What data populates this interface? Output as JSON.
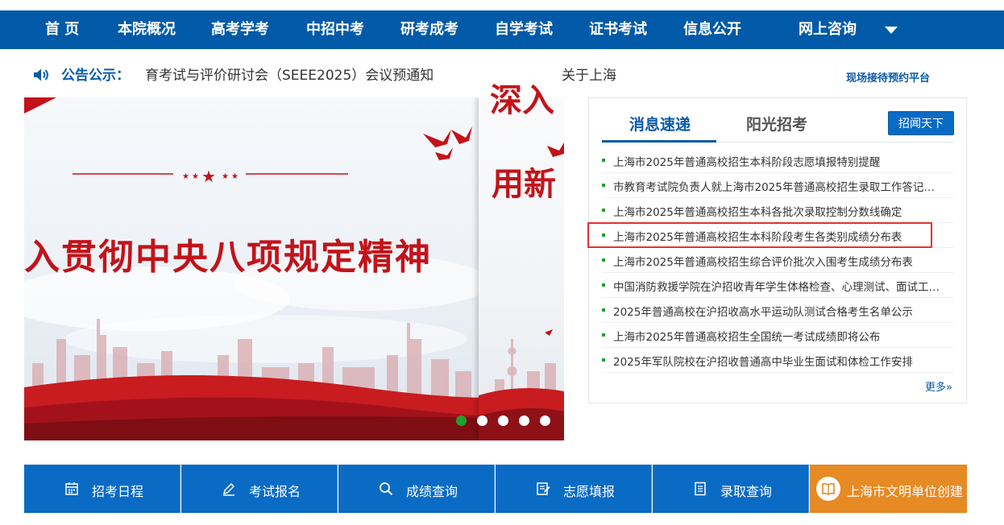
{
  "nav": {
    "items": [
      "首 页",
      "本院概况",
      "高考学考",
      "中招中考",
      "研考成考",
      "自学考试",
      "证书考试",
      "信息公开",
      "网上咨询"
    ]
  },
  "notice": {
    "label": "公告公示：",
    "marquee": [
      "育考试与评价研讨会（SEEE2025）会议预通知",
      "关于上海"
    ],
    "reservation": "现场接待预约平台"
  },
  "banner": {
    "slogan_main": "入贯彻中央八项规定精神",
    "slogan_right_top": "深入",
    "slogan_right_bottom": "用新",
    "slides_count": 5,
    "active_slide": 0
  },
  "news": {
    "tabs": [
      "消息速递",
      "阳光招考"
    ],
    "active_tab": 0,
    "button": "招闻天下",
    "items": [
      "上海市2025年普通高校招生本科阶段志愿填报特别提醒",
      "市教育考试院负责人就上海市2025年普通高校招生录取工作答记者问",
      "上海市2025年普通高校招生本科各批次录取控制分数线确定",
      "上海市2025年普通高校招生本科阶段考生各类别成绩分布表",
      "上海市2025年普通高校招生综合评价批次入围考生成绩分布表",
      "中国消防救援学院在沪招收青年学生体格检查、心理测试、面试工作安排",
      "2025年普通高校在沪招收高水平运动队测试合格考生名单公示",
      "上海市2025年普通高校招生全国统一考试成绩即将公布",
      "2025年军队院校在沪招收普通高中毕业生面试和体检工作安排"
    ],
    "highlighted_index": 3,
    "more": "更多»"
  },
  "quickbar": {
    "items": [
      "招考日程",
      "考试报名",
      "成绩查询",
      "志愿填报",
      "录取查询",
      "上海市文明单位创建"
    ]
  },
  "colors": {
    "nav_bg": "#005aa7",
    "accent_blue": "#0a5aa9",
    "button_blue": "#0a6bc4",
    "slogan_red": "#c2131a",
    "highlight_red": "#e8302b",
    "bullet_green": "#1fa02a",
    "orange": "#e68a23"
  }
}
